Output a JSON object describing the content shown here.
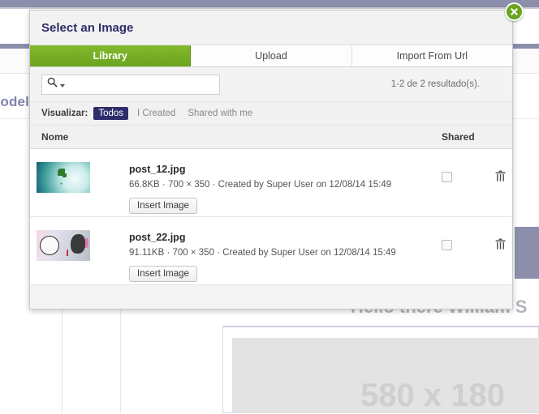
{
  "background": {
    "brand": "Modelo",
    "greeting": "Hello there William S",
    "placeholder_label": "580 x 180"
  },
  "modal": {
    "title": "Select an Image",
    "close_icon": "close-circle-icon",
    "tabs": [
      {
        "label": "Library",
        "active": true
      },
      {
        "label": "Upload",
        "active": false
      },
      {
        "label": "Import From Url",
        "active": false
      }
    ],
    "search": {
      "icon": "search-icon",
      "value": "",
      "placeholder": "",
      "caret_icon": "chevron-down-icon"
    },
    "result_count": "1-2 de 2 resultado(s).",
    "filter": {
      "label": "Visualizar:",
      "options": [
        {
          "label": "Todos",
          "active": true
        },
        {
          "label": "I Created",
          "active": false
        },
        {
          "label": "Shared with me",
          "active": false
        }
      ]
    },
    "table": {
      "columns": {
        "name": "Nome",
        "shared": "Shared"
      },
      "rows": [
        {
          "name": "post_12.jpg",
          "meta": "66.8KB · 700 × 350 · Created by Super User on 12/08/14 15:49",
          "insert_label": "Insert Image",
          "shared_checked": false,
          "delete_icon": "trash-icon",
          "thumb_name": "thumbnail-plant"
        },
        {
          "name": "post_22.jpg",
          "meta": "91.11KB · 700 × 350 · Created by Super User on 12/08/14 15:49",
          "insert_label": "Insert Image",
          "shared_checked": false,
          "delete_icon": "trash-icon",
          "thumb_name": "thumbnail-graffiti"
        }
      ]
    }
  },
  "colors": {
    "accent_green": "#6ca320",
    "accent_navy": "#2e2d6b",
    "bar_purple": "#8b8fab"
  }
}
